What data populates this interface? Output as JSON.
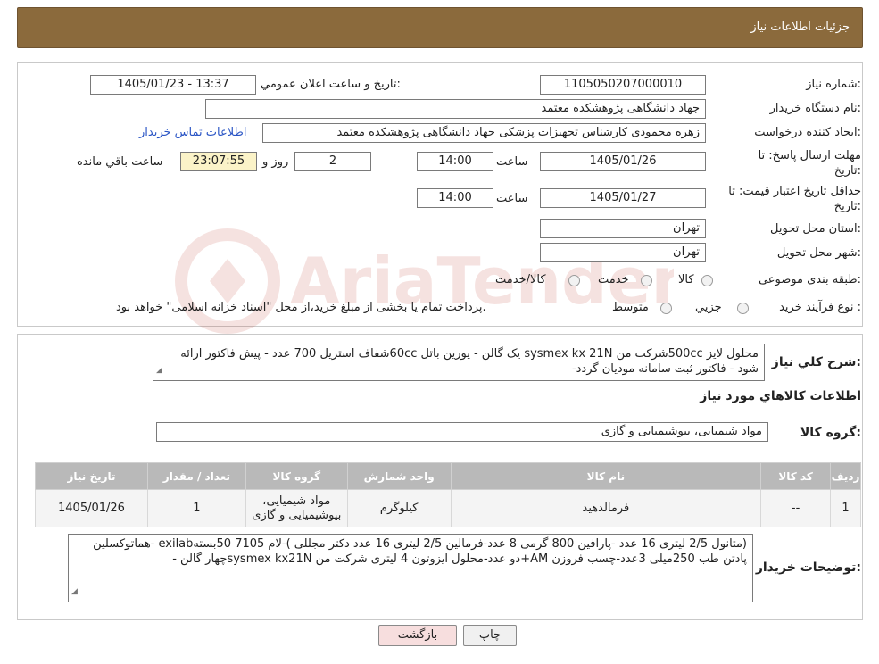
{
  "header": {
    "title": "جزئیات اطلاعات نیاز"
  },
  "need": {
    "need_number_label": "شماره نیاز:",
    "need_number": "1105050207000010",
    "announce_label": "تاریخ و ساعت اعلان عمومي:",
    "announce_value": "1405/01/23 - 13:37",
    "buyer_org_label": "نام دستگاه خریدار:",
    "buyer_org": "جهاد دانشگاهی پژوهشکده معتمد",
    "creator_label": "ایجاد کننده درخواست:",
    "creator": "زهره محمودی کارشناس تجهیزات پزشکی جهاد دانشگاهی پژوهشکده معتمد",
    "contact_link": "اطلاعات تماس خریدار",
    "deadline_label_1": "مهلت ارسال پاسخ: تا",
    "deadline_label_2": "تاریخ:",
    "deadline_date": "1405/01/26",
    "time_label": "ساعت",
    "deadline_time": "14:00",
    "days_value": "2",
    "days_label": "روز و",
    "remaining_time": "23:07:55",
    "remaining_label": "ساعت باقي مانده",
    "validity_label_1": "حداقل تاریخ اعتبار قیمت: تا",
    "validity_label_2": "تاریخ:",
    "validity_date": "1405/01/27",
    "validity_time": "14:00",
    "province_label": "استان محل تحویل:",
    "province": "تهران",
    "city_label": "شهر محل تحویل:",
    "city": "تهران",
    "category_label": "طبقه بندی موضوعی:",
    "category_options": [
      "کالا",
      "خدمت",
      "کالا/خدمت"
    ],
    "process_label": "نوع فرآیند خرید :",
    "process_options": [
      "جزیي",
      "متوسط"
    ],
    "process_note": "پرداخت تمام یا بخشی از مبلغ خرید،از محل \"اسناد خزانه اسلامی\" خواهد بود."
  },
  "summary": {
    "label": "شرح کلي نياز:",
    "text": "محلول لایز 500ccشرکت من sysmex kx 21N یک گالن - یورین باتل 60ccشفاف استریل 700 عدد - پیش فاکتور ارائه شود - فاکتور ثبت سامانه مودیان گردد-"
  },
  "goods_section": {
    "title": "اطلاعات کالاهاي مورد نياز",
    "group_label": "گروه کالا:",
    "group_value": "مواد شیمیایی، بیوشیمیایی و  گازی"
  },
  "table": {
    "headers": [
      "رديف",
      "کد کالا",
      "نام کالا",
      "واحد شمارش",
      "گروه کالا",
      "تعداد / مقدار",
      "تاريخ نياز"
    ],
    "rows": [
      [
        "1",
        "--",
        "فرمالدهید",
        "کیلوگرم",
        "مواد شیمیایی، بیوشیمیایی و گازی",
        "1",
        "1405/01/26"
      ]
    ]
  },
  "buyer_notes": {
    "label": "توضیحات خریدار:",
    "text": "(متانول 2/5 لیتری 16 عدد -پارافین 800 گرمی 8 عدد-فرمالین 2/5 لیتری 16 عدد دکتر مجللی )-لام 7105   50بستهexilab -هماتوکسلین پادتن طب 250میلی 3عدد-چسب فروزن AM+دو عدد-محلول ایزوتون 4 لیتری شرکت من sysmex kx21Nچهار گالن -"
  },
  "buttons": {
    "print": "چاپ",
    "back": "بازگشت"
  },
  "watermark": {
    "text": "AriaTender.neT"
  }
}
